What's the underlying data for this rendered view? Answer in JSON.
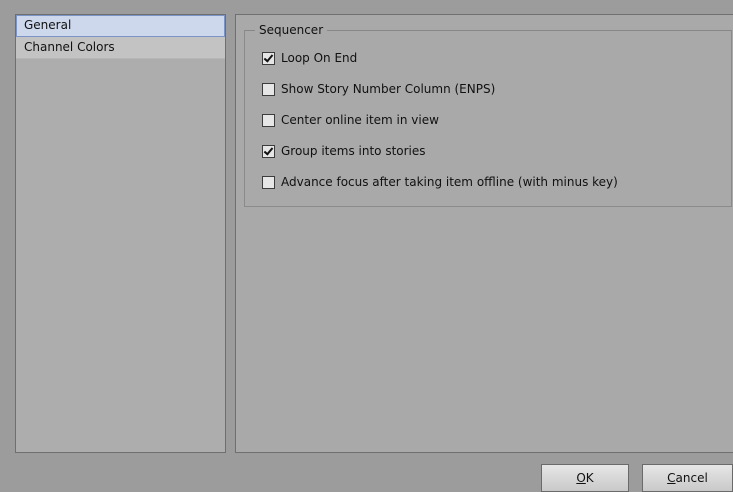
{
  "sidebar": {
    "items": [
      {
        "label": "General"
      },
      {
        "label": "Channel Colors"
      }
    ]
  },
  "sequencer": {
    "title": "Sequencer",
    "options": [
      {
        "label": "Loop On End",
        "checked": true
      },
      {
        "label": "Show Story Number Column (ENPS)",
        "checked": false
      },
      {
        "label": "Center online item in view",
        "checked": false
      },
      {
        "label": "Group items into stories",
        "checked": true
      },
      {
        "label": "Advance focus after taking item offline (with minus key)",
        "checked": false
      }
    ]
  },
  "buttons": {
    "ok": "OK",
    "cancel": "Cancel"
  }
}
